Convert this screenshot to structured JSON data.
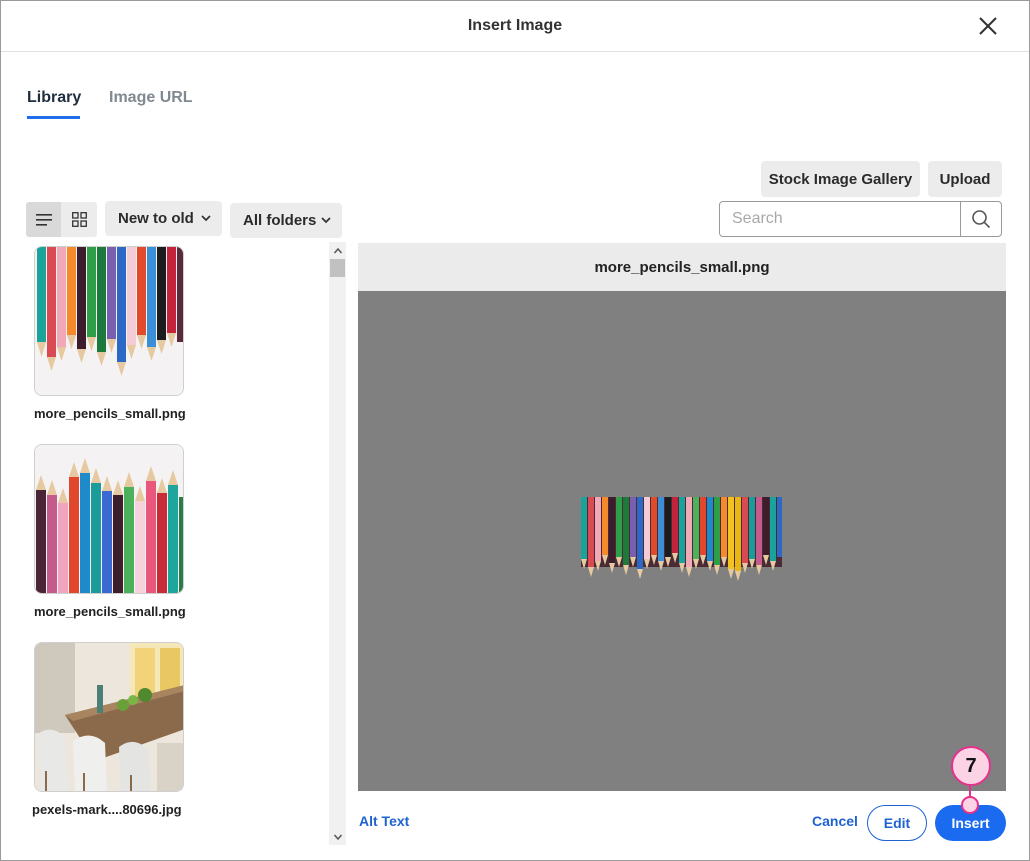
{
  "dialog": {
    "title": "Insert Image"
  },
  "tabs": [
    {
      "label": "Library",
      "active": true
    },
    {
      "label": "Image URL",
      "active": false
    }
  ],
  "actions": {
    "stock_gallery": "Stock Image Gallery",
    "upload": "Upload"
  },
  "toolbar": {
    "sort_selected": "New to old",
    "folder_selected": "All folders"
  },
  "search": {
    "placeholder": "Search",
    "value": ""
  },
  "library": {
    "items": [
      {
        "filename": "more_pencils_small.png"
      },
      {
        "filename": "more_pencils_small.png"
      },
      {
        "filename": "pexels-mark....80696.jpg"
      }
    ]
  },
  "preview": {
    "filename": "more_pencils_small.png"
  },
  "footer": {
    "alt_text": "Alt Text",
    "cancel": "Cancel",
    "edit": "Edit",
    "insert": "Insert"
  },
  "annotation": {
    "step": "7"
  },
  "colors": {
    "accent": "#1a6bf0",
    "link": "#1f63d3",
    "callout_fill": "#fbd3e5",
    "callout_border": "#e6318c",
    "preview_bg": "#808080"
  }
}
